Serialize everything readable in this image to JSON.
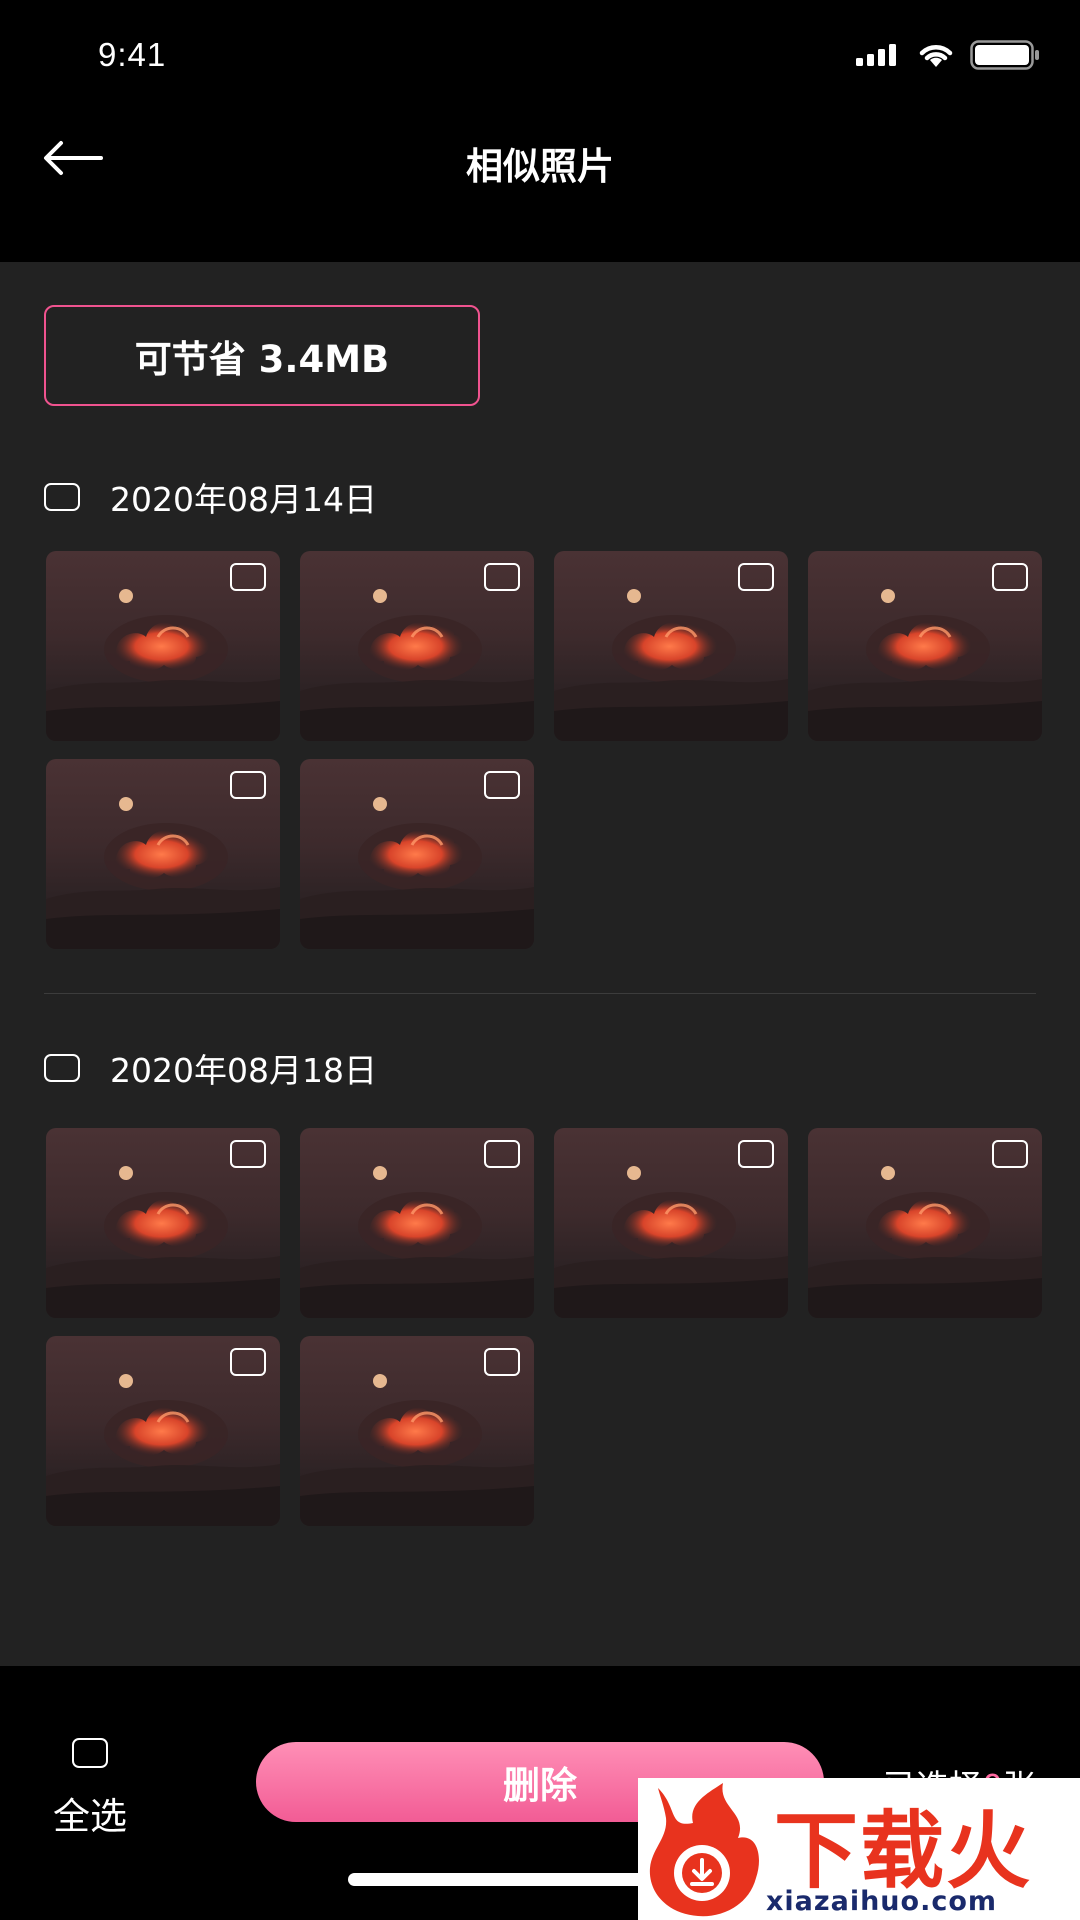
{
  "status_bar": {
    "time": "9:41"
  },
  "header": {
    "title": "相似照片"
  },
  "savings": {
    "label": "可节省 3.4MB"
  },
  "groups": [
    {
      "date": "2020年08月14日",
      "photo_count": 6
    },
    {
      "date": "2020年08月18日",
      "photo_count": 6
    }
  ],
  "bottom_bar": {
    "select_all_label": "全选",
    "delete_label": "删除",
    "selected_prefix": "已选择",
    "selected_count": "0",
    "selected_suffix": "张"
  },
  "watermark": {
    "brand": "下载火",
    "url": "xiazaihuo.com"
  },
  "colors": {
    "accent": "#f0538f",
    "background": "#222222",
    "bar": "#000000"
  }
}
